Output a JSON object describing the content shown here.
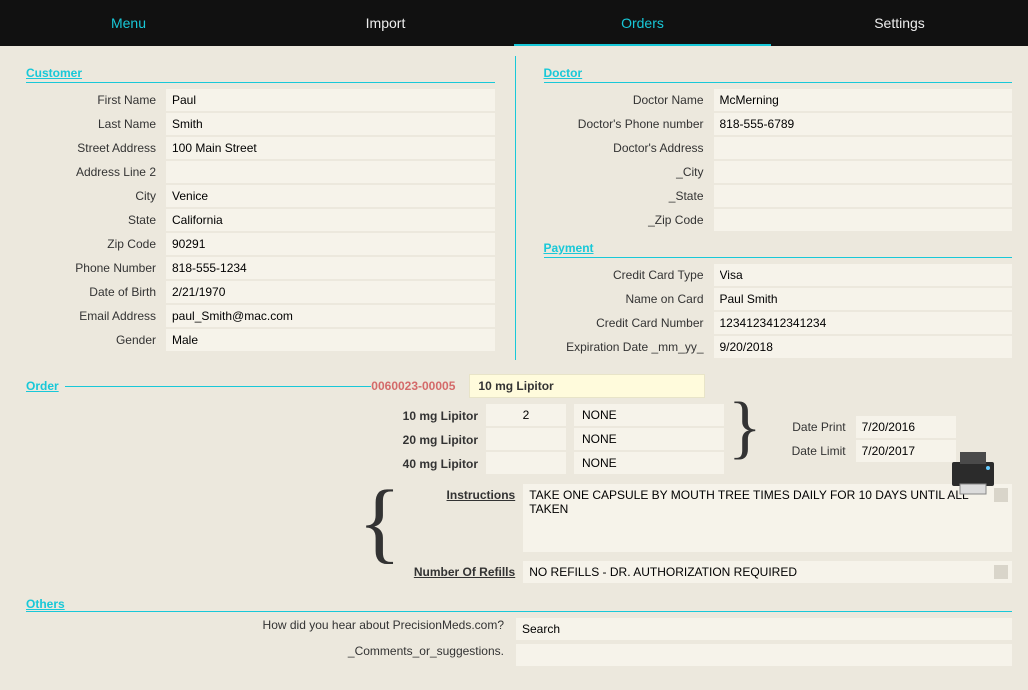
{
  "nav": {
    "menu": "Menu",
    "import": "Import",
    "orders": "Orders",
    "settings": "Settings"
  },
  "sections": {
    "customer": "Customer",
    "doctor": "Doctor",
    "payment": "Payment",
    "order": "Order",
    "others": "Others"
  },
  "customer": {
    "labels": {
      "first_name": "First Name",
      "last_name": "Last Name",
      "street": "Street Address",
      "addr2": "Address Line 2",
      "city": "City",
      "state": "State",
      "zip": "Zip Code",
      "phone": "Phone Number",
      "dob": "Date of Birth",
      "email": "Email Address",
      "gender": "Gender"
    },
    "first_name": "Paul",
    "last_name": "Smith",
    "street": "100 Main Street",
    "addr2": "",
    "city": "Venice",
    "state": "California",
    "zip": "90291",
    "phone": "818-555-1234",
    "dob": "2/21/1970",
    "email": "paul_Smith@mac.com",
    "gender": "Male"
  },
  "doctor": {
    "labels": {
      "name": "Doctor Name",
      "phone": "Doctor's Phone number",
      "addr": "Doctor's Address",
      "city": "_City",
      "state": "_State",
      "zip": "_Zip Code"
    },
    "name": "McMerning",
    "phone": "818-555-6789",
    "addr": "",
    "city": "",
    "state": "",
    "zip": ""
  },
  "payment": {
    "labels": {
      "type": "Credit Card Type",
      "name": "Name on Card",
      "number": "Credit Card Number",
      "exp": "Expiration Date _mm_yy_"
    },
    "type": "Visa",
    "name": "Paul Smith",
    "number": "1234123412341234",
    "exp": "9/20/2018"
  },
  "order": {
    "number": "0060023-00005",
    "product": "10 mg Lipitor",
    "labels": {
      "l10": "10 mg Lipitor",
      "l20": "20 mg Lipitor",
      "l40": "40 mg Lipitor",
      "instructions": "Instructions",
      "refills": "Number Of Refills",
      "date_print": "Date Print",
      "date_limit": "Date Limit"
    },
    "qty": {
      "q10": "2",
      "q20": "",
      "q40": ""
    },
    "opt": {
      "o10": "NONE",
      "o20": "NONE",
      "o40": "NONE"
    },
    "date_print": "7/20/2016",
    "date_limit": "7/20/2017",
    "instructions": "TAKE ONE CAPSULE BY MOUTH TREE TIMES DAILY FOR 10 DAYS UNTIL ALL TAKEN",
    "refills": "NO REFILLS - DR. AUTHORIZATION REQUIRED"
  },
  "others": {
    "labels": {
      "hear": "How did you hear about PrecisionMeds.com?",
      "comments": "_Comments_or_suggestions."
    },
    "hear": "Search",
    "comments": ""
  }
}
